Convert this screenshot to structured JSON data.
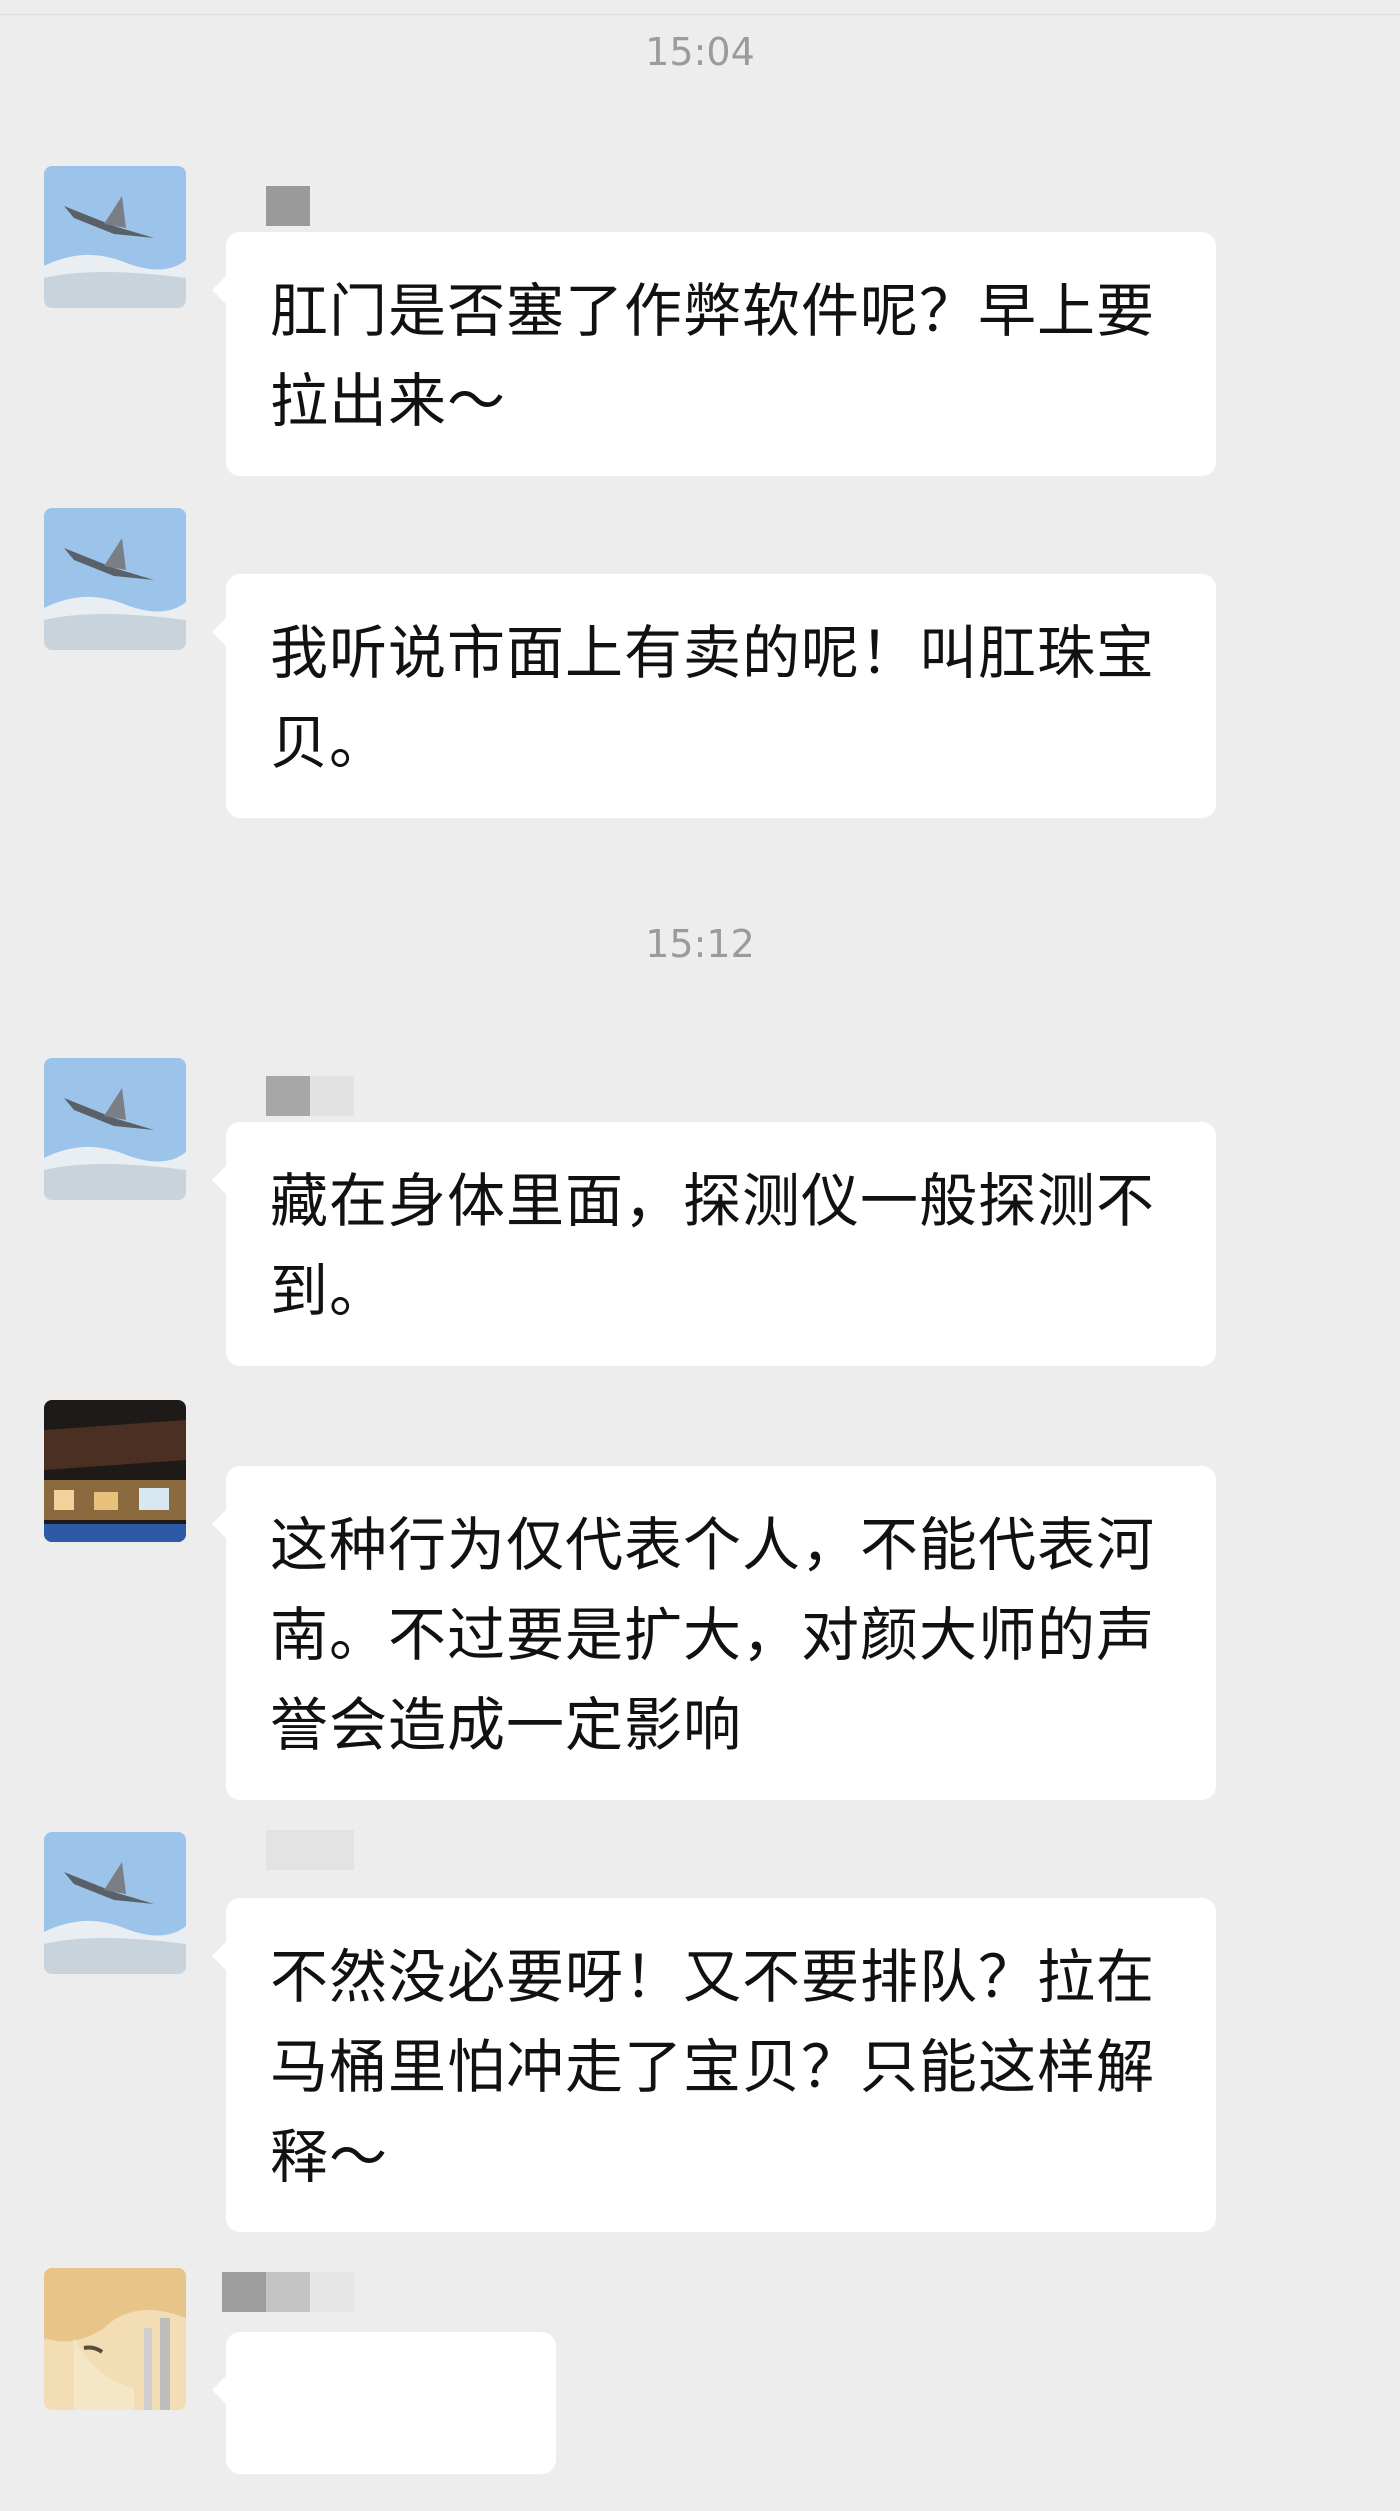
{
  "timestamps": [
    "15:04",
    "15:12"
  ],
  "messages": [
    {
      "text": "肛门是否塞了作弊软件呢？早上要拉出来～"
    },
    {
      "text": "我听说市面上有卖的呢！叫肛珠宝贝。"
    },
    {
      "text": "藏在身体里面，探测仪一般探测不到。"
    },
    {
      "text": "这种行为仅代表个人，不能代表河南。不过要是扩大，对颜大师的声誉会造成一定影响"
    },
    {
      "text": "不然没必要呀！又不要排队？拉在马桶里怕冲走了宝贝？只能这样解释～"
    },
    {
      "text": ""
    }
  ]
}
